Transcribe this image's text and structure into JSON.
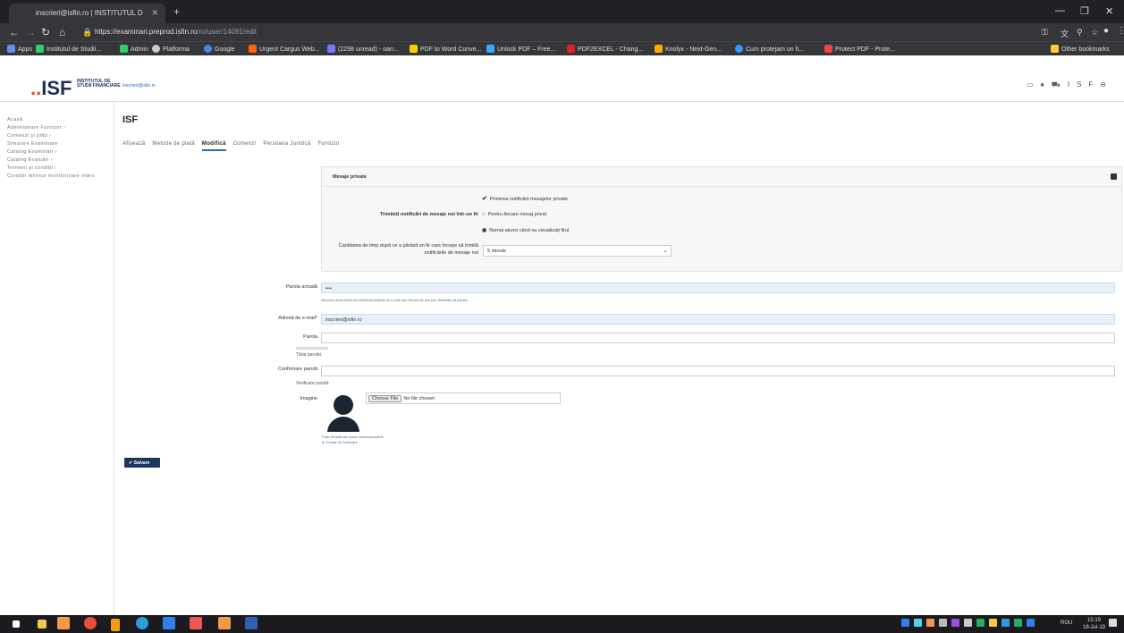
{
  "browser": {
    "tab_title": "inscrieri@isfin.ro | INSTITUTUL D",
    "url_host": "https://examinari.preprod.isfin.ro",
    "url_path": "/ro/user/14081/edit",
    "bookmarks": [
      "Apps",
      "Institutul de Studii...",
      "Admin",
      "Platforma",
      "Google",
      "Urgent Cargus Web...",
      "(2298 unread) - oan...",
      "PDF to Word Conve...",
      "Unlock PDF – Free...",
      "PDF2EXCEL - Chang...",
      "Knolyx - Next-Gen...",
      "Cum protejam un fi...",
      "Protect PDF - Prote..."
    ],
    "other_bookmarks": "Other bookmarks"
  },
  "header": {
    "logo_text": "ISF",
    "logo_dots": "..",
    "logo_sub": "INSTITUTUL DE STUDII FINANCIARE",
    "email": "inscrieri@isfin.ro",
    "user_initials": "ISF"
  },
  "sidebar": {
    "items": [
      "Acasă",
      "Administrare Furnizor ›",
      "Comenzi și plăți ›",
      "Simulare Examinare",
      "Catalog Examinări ›",
      "Catalog Evaluări ›",
      "Termeni și condiții ›",
      "Condiții tehnice monitorizare video"
    ]
  },
  "page": {
    "title": "ISF",
    "tabs": [
      "Afișează",
      "Metode de plată",
      "Modifică",
      "Comenzi",
      "Persoana Juridică",
      "Furnizor"
    ],
    "active_tab": "Modifică"
  },
  "private_messages": {
    "heading": "Mesaje private",
    "enable_label": "Primirea notificării mesajelor private",
    "notify_label": "Trimiteți notificări de mesaje noi într-un fir",
    "option1": "Pentru fiecare mesaj privat",
    "option2": "Numai atunci când nu vizualizați firul",
    "delay_label": "Cantitatea de timp după ce a părăsit un fir care începe să trimită notificările de mesaje noi",
    "delay_value": "5 minute"
  },
  "form": {
    "current_password_label": "Parola actuală",
    "current_password_value": "••••",
    "current_password_help": "Necesar dacă doriți să schimbați Adresă de e-mail sau Parola de mai jos.",
    "reset_link": "Resetați-vă parola.",
    "email_label": "Adresă de e-mail",
    "email_value": "inscrieri@isfin.ro",
    "password_label": "Parola",
    "strength_label": "Tăria parolei:",
    "confirm_label": "Confirmare parolă",
    "match_label": "Verificare parolă:",
    "image_label": "Imagine",
    "choose_file": "Choose File",
    "no_file": "No file chosen",
    "image_help": "Fața virtuală sau poza dumneavoastră.",
    "upload_req": "Cerințe de încărcare",
    "save_label": "Salvare"
  },
  "taskbar": {
    "lang": "ROU",
    "time": "15:19",
    "date": "18-Jul-19"
  }
}
